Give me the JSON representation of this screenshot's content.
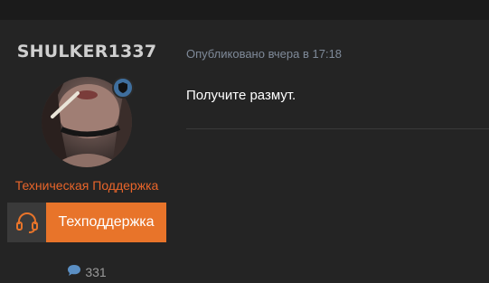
{
  "author": {
    "username": "SHULKER1337",
    "role": "Техническая Поддержка",
    "support_label": "Техподдержка",
    "reaction_count": "331",
    "badge_icon": "shield-icon",
    "support_icon": "headset-icon",
    "reaction_icon": "chat-bubble-icon"
  },
  "post": {
    "date": "Опубликовано вчера в 17:18",
    "text": "Получите размут."
  },
  "colors": {
    "role": "#e8652a",
    "support_button": "#e8742a",
    "badge": "#3f6f9e"
  }
}
